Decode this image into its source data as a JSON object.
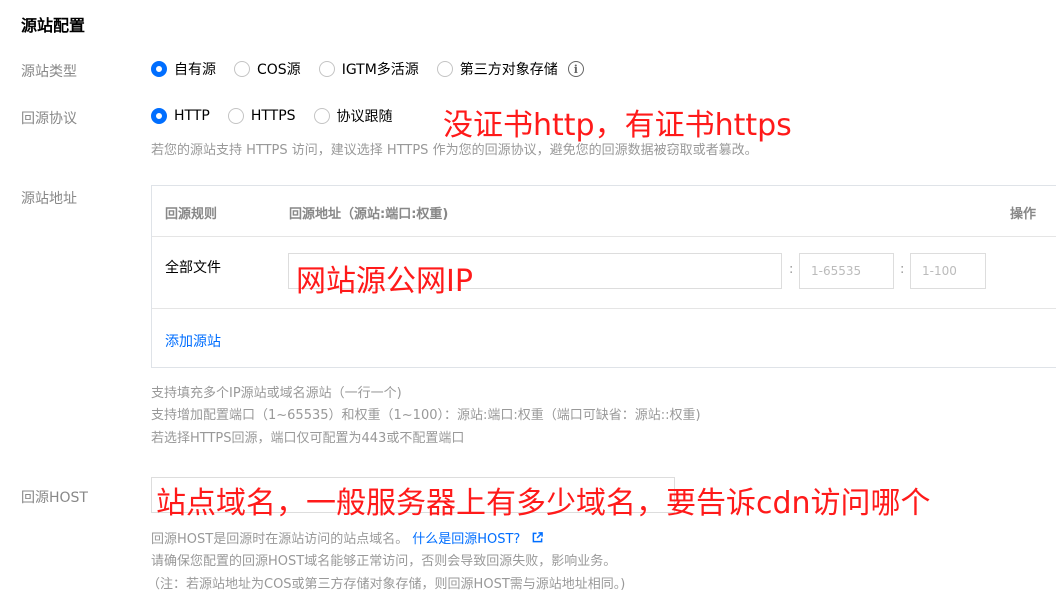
{
  "section": {
    "title": "源站配置"
  },
  "origin_type": {
    "label": "源站类型",
    "options": [
      "自有源",
      "COS源",
      "IGTM多活源",
      "第三方对象存储"
    ],
    "selected": "自有源"
  },
  "protocol": {
    "label": "回源协议",
    "options": [
      "HTTP",
      "HTTPS",
      "协议跟随"
    ],
    "selected": "HTTP",
    "hint": "若您的源站支持 HTTPS 访问，建议选择 HTTPS 作为您的回源协议，避免您的回源数据被窃取或者篡改。"
  },
  "origin_address": {
    "label": "源站地址",
    "table": {
      "headers": [
        "回源规则",
        "回源地址（源站:端口:权重)",
        "操作"
      ],
      "row_name": "全部文件",
      "address_value": "",
      "port_placeholder": "1-65535",
      "weight_placeholder": "1-100",
      "add_link": "添加源站"
    },
    "hints": [
      "支持填充多个IP源站或域名源站（一行一个)",
      "支持增加配置端口（1~65535）和权重（1~100）：源站:端口:权重（端口可缺省：源站::权重)",
      "若选择HTTPS回源，端口仅可配置为443或不配置端口"
    ]
  },
  "host": {
    "label": "回源HOST",
    "value": "",
    "hint1": "回源HOST是回源时在源站访问的站点域名。",
    "hint1_link": "什么是回源HOST?",
    "hint2": "请确保您配置的回源HOST域名能够正常访问，否则会导致回源失败，影响业务。",
    "hint3": "（注：若源站地址为COS或第三方存储对象存储，则回源HOST需与源站地址相同。)"
  },
  "annotations": {
    "protocol_note": "没证书http，有证书https",
    "address_note": "网站源公网IP",
    "host_note": "站点域名，一般服务器上有多少域名，要告诉cdn访问哪个"
  },
  "colors": {
    "accent": "#006eff",
    "annotation": "#ff1a1a"
  },
  "icons": {
    "info": "info-icon",
    "external_link": "external-link-icon"
  }
}
